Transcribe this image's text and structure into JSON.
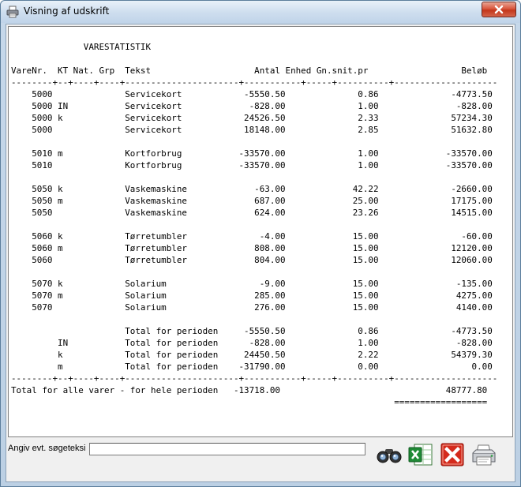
{
  "window": {
    "title": "Visning af udskrift",
    "close_glyph": "✕"
  },
  "report": {
    "lines": [
      "",
      "              VARESTATISTIK",
      "",
      "VareNr.  KT Nat. Grp  Tekst                    Antal Enhed Gn.snit.pr                  Beløb",
      "--------+--+----+----+----------------------+-----------+-----+----------+--------------------",
      "    5000              Servicekort            -5550.50              0.86              -4773.50",
      "    5000 IN           Servicekort             -828.00              1.00               -828.00",
      "    5000 k            Servicekort            24526.50              2.33              57234.30",
      "    5000              Servicekort            18148.00              2.85              51632.80",
      "",
      "    5010 m            Kortforbrug           -33570.00              1.00             -33570.00",
      "    5010              Kortforbrug           -33570.00              1.00             -33570.00",
      "",
      "    5050 k            Vaskemaskine             -63.00             42.22              -2660.00",
      "    5050 m            Vaskemaskine             687.00             25.00              17175.00",
      "    5050              Vaskemaskine             624.00             23.26              14515.00",
      "",
      "    5060 k            Tørretumbler              -4.00             15.00                -60.00",
      "    5060 m            Tørretumbler             808.00             15.00              12120.00",
      "    5060              Tørretumbler             804.00             15.00              12060.00",
      "",
      "    5070 k            Solarium                  -9.00             15.00               -135.00",
      "    5070 m            Solarium                 285.00             15.00               4275.00",
      "    5070              Solarium                 276.00             15.00               4140.00",
      "",
      "                      Total for perioden     -5550.50              0.86              -4773.50",
      "         IN           Total for perioden      -828.00              1.00               -828.00",
      "         k            Total for perioden     24450.50              2.22              54379.30",
      "         m            Total for perioden    -31790.00              0.00                  0.00",
      "--------+--+----+----+----------------------+-----------+-----+----------+--------------------",
      "Total for alle varer - for hele perioden   -13718.00                                48777.80",
      "                                                                          =================="
    ]
  },
  "search": {
    "label": "Angiv evt. søgeteksi",
    "value": ""
  },
  "toolbar": {
    "icons": [
      "binoculars-icon",
      "excel-icon",
      "cancel-icon",
      "printer-icon"
    ],
    "excel_letter": "X"
  },
  "colors": {
    "title_gradient": "#cdddee",
    "close_red": "#c3361b",
    "excel_green": "#1f8a35",
    "cancel_red": "#d42a1c"
  }
}
